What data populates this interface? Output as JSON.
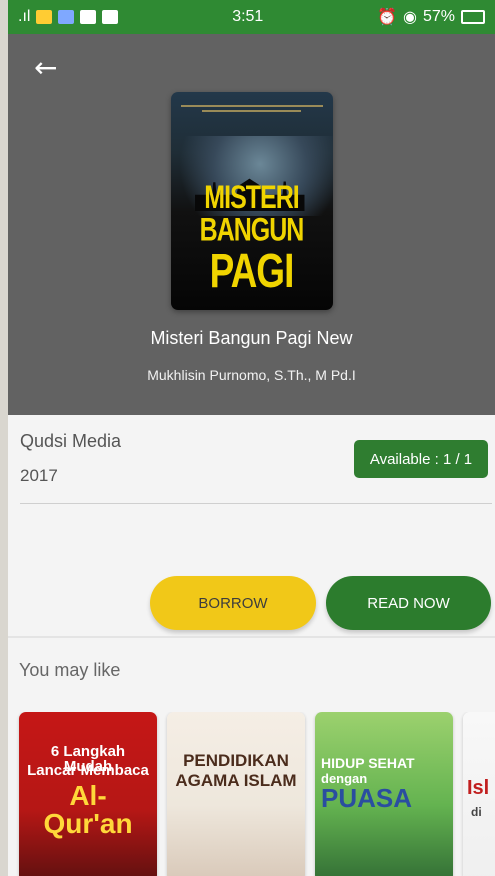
{
  "statusbar": {
    "signal": ".ıl",
    "time": "3:51",
    "battery": "57%"
  },
  "header": {
    "back_icon": "arrow-left-icon"
  },
  "book": {
    "title": "Misteri Bangun Pagi New",
    "author": "Mukhlisin Purnomo, S.Th., M Pd.I",
    "cover": {
      "line1": "MISTERI",
      "line2": "BANGUN",
      "line3": "PAGI"
    },
    "publisher": "Qudsi Media",
    "year": "2017",
    "availability": "Available : 1 / 1"
  },
  "actions": {
    "borrow": "BORROW",
    "read_now": "READ NOW"
  },
  "recommendations": {
    "heading": "You may like",
    "items": [
      {
        "cover": {
          "line1": "6 Langkah Mudah",
          "line2": "Lancar Membaca",
          "line3": "Al-Qur'an"
        }
      },
      {
        "cover": {
          "line1": "PENDIDIKAN",
          "line2": "AGAMA ISLAM"
        }
      },
      {
        "cover": {
          "line1": "HIDUP SEHAT",
          "line2": "dengan",
          "line3": "PUASA"
        }
      },
      {
        "cover": {
          "line1": "Isl",
          "line2": "di"
        }
      }
    ]
  }
}
